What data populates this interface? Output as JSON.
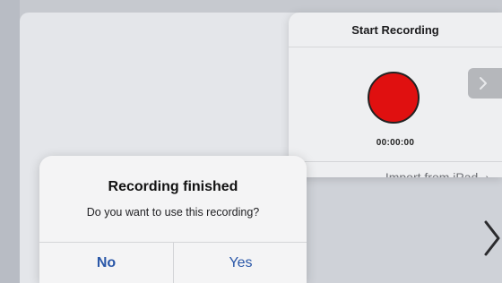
{
  "popover": {
    "title": "Start Recording",
    "timer": "00:00:00",
    "import_label": "Import from iPad",
    "record_color": "#e01010"
  },
  "alert": {
    "title": "Recording finished",
    "message": "Do you want to use this recording?",
    "no_label": "No",
    "yes_label": "Yes",
    "button_color": "#2a57a8"
  },
  "icons": {
    "import_chevron": "chevron-right-icon",
    "side_arrow": "chevron-right-icon",
    "background_chevron": "chevron-right-icon"
  }
}
